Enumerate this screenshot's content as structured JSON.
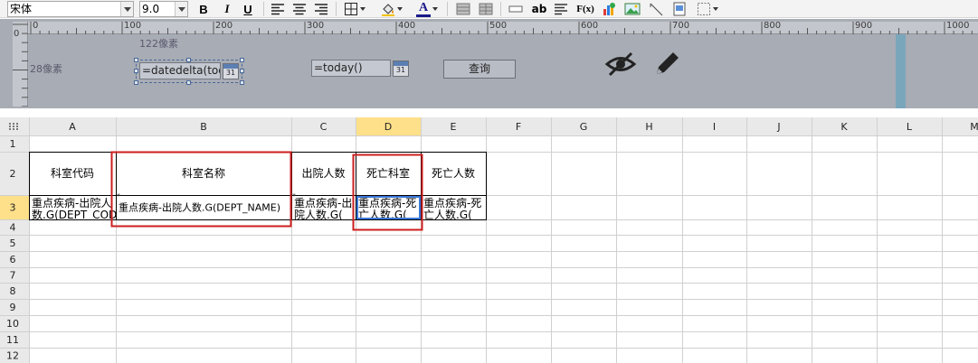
{
  "toolbar": {
    "font_name": "宋体",
    "font_size": "9.0",
    "bold_label": "B",
    "italic_label": "I",
    "underline_label": "U",
    "text_color_label": "A",
    "abbreviation_label": "ab",
    "formula_label": "F(x)",
    "icons": [
      "bold-icon",
      "italic-icon",
      "underline-icon",
      "align-left-icon",
      "align-center-icon",
      "align-right-icon",
      "border-icon",
      "fill-color-icon",
      "font-color-icon",
      "merge-icon",
      "unmerge-icon",
      "textfield-icon",
      "abbreviation-icon",
      "paragraph-icon",
      "formula-icon",
      "chart-icon",
      "image-icon",
      "slash-icon",
      "subreport-icon",
      "frame-icon"
    ]
  },
  "param_panel": {
    "ruler_top_labels": [
      "0",
      "100",
      "200",
      "300",
      "400",
      "500",
      "600",
      "700",
      "800",
      "900",
      "1000"
    ],
    "ruler_left_label": "0",
    "hint_x": "122像素",
    "hint_y": "28像素",
    "start_date_formula": "=datedelta(toda",
    "end_date_formula": "=today()",
    "calendar_day": "31",
    "query_button": "查询",
    "icons": [
      "hide-icon",
      "edit-pencil-icon",
      "calendar-icon"
    ]
  },
  "sheet": {
    "columns": [
      "A",
      "B",
      "C",
      "D",
      "E",
      "F",
      "G",
      "H",
      "I",
      "J",
      "K",
      "L",
      "M"
    ],
    "rows": [
      "1",
      "2",
      "3",
      "4",
      "5",
      "6",
      "7",
      "8",
      "9",
      "10",
      "11",
      "12"
    ],
    "selected_column": "D",
    "selected_row": "3",
    "headers": {
      "A": "科室代码",
      "B": "科室名称",
      "C": "出院人数",
      "D": "死亡科室",
      "E": "死亡人数"
    },
    "data_row": {
      "A": [
        "重点疾病-出院人",
        "数.G(DEPT_CODE)"
      ],
      "B": [
        "重点疾病-出院人数.G(DEPT_NAME)"
      ],
      "C": [
        "重点疾病-出",
        "院人数.G("
      ],
      "D": [
        "重点疾病-死",
        "亡人数.G("
      ],
      "E": [
        "重点疾病-死",
        "亡人数.G("
      ]
    },
    "highlight_color": "#cc1f1f",
    "selection_color": "#3b78d8"
  }
}
